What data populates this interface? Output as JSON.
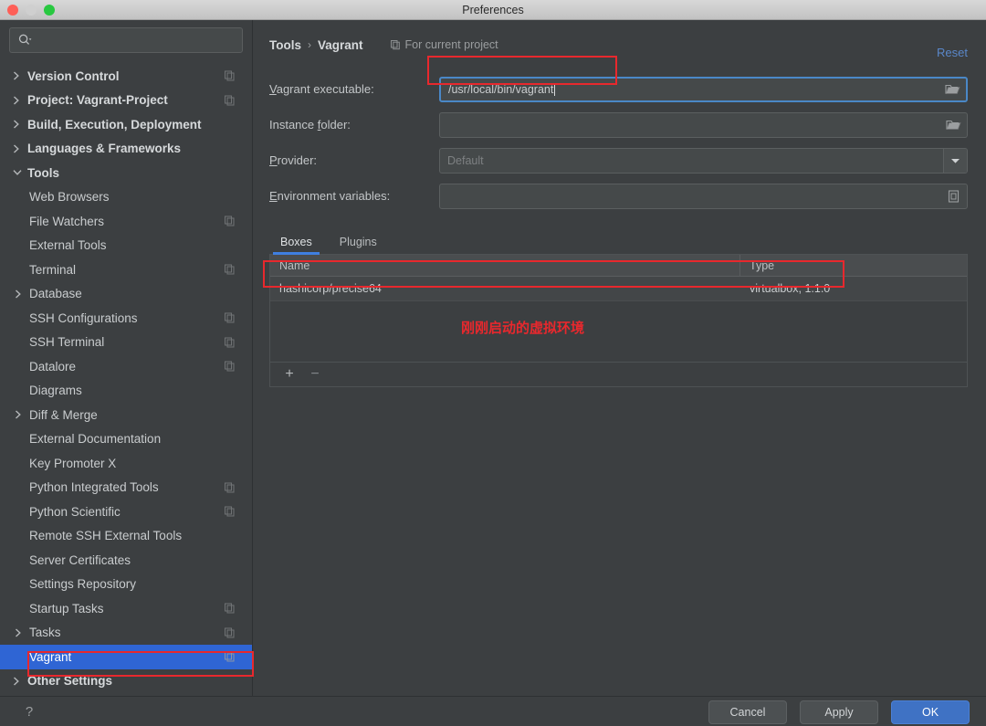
{
  "window": {
    "title": "Preferences",
    "traffic_lights": [
      "close",
      "minimize",
      "zoom"
    ]
  },
  "search": {
    "placeholder": "",
    "value": "",
    "icon": "search-icon"
  },
  "sidebar": {
    "items": [
      {
        "label": "Version Control",
        "level": 0,
        "arrow": "collapsed",
        "copy_icon": true,
        "selected": false,
        "bold": true
      },
      {
        "label": "Project: Vagrant-Project",
        "level": 0,
        "arrow": "collapsed",
        "copy_icon": true,
        "selected": false,
        "bold": true
      },
      {
        "label": "Build, Execution, Deployment",
        "level": 0,
        "arrow": "collapsed",
        "copy_icon": false,
        "selected": false,
        "bold": true
      },
      {
        "label": "Languages & Frameworks",
        "level": 0,
        "arrow": "collapsed",
        "copy_icon": false,
        "selected": false,
        "bold": true
      },
      {
        "label": "Tools",
        "level": 0,
        "arrow": "expanded",
        "copy_icon": false,
        "selected": false,
        "bold": true
      },
      {
        "label": "Web Browsers",
        "level": 1,
        "arrow": "none",
        "copy_icon": false,
        "selected": false,
        "bold": false
      },
      {
        "label": "File Watchers",
        "level": 1,
        "arrow": "none",
        "copy_icon": true,
        "selected": false,
        "bold": false
      },
      {
        "label": "External Tools",
        "level": 1,
        "arrow": "none",
        "copy_icon": false,
        "selected": false,
        "bold": false
      },
      {
        "label": "Terminal",
        "level": 1,
        "arrow": "none",
        "copy_icon": true,
        "selected": false,
        "bold": false
      },
      {
        "label": "Database",
        "level": 1,
        "arrow": "collapsed",
        "copy_icon": false,
        "selected": false,
        "bold": false
      },
      {
        "label": "SSH Configurations",
        "level": 1,
        "arrow": "none",
        "copy_icon": true,
        "selected": false,
        "bold": false
      },
      {
        "label": "SSH Terminal",
        "level": 1,
        "arrow": "none",
        "copy_icon": true,
        "selected": false,
        "bold": false
      },
      {
        "label": "Datalore",
        "level": 1,
        "arrow": "none",
        "copy_icon": true,
        "selected": false,
        "bold": false
      },
      {
        "label": "Diagrams",
        "level": 1,
        "arrow": "none",
        "copy_icon": false,
        "selected": false,
        "bold": false
      },
      {
        "label": "Diff & Merge",
        "level": 1,
        "arrow": "collapsed",
        "copy_icon": false,
        "selected": false,
        "bold": false
      },
      {
        "label": "External Documentation",
        "level": 1,
        "arrow": "none",
        "copy_icon": false,
        "selected": false,
        "bold": false
      },
      {
        "label": "Key Promoter X",
        "level": 1,
        "arrow": "none",
        "copy_icon": false,
        "selected": false,
        "bold": false
      },
      {
        "label": "Python Integrated Tools",
        "level": 1,
        "arrow": "none",
        "copy_icon": true,
        "selected": false,
        "bold": false
      },
      {
        "label": "Python Scientific",
        "level": 1,
        "arrow": "none",
        "copy_icon": true,
        "selected": false,
        "bold": false
      },
      {
        "label": "Remote SSH External Tools",
        "level": 1,
        "arrow": "none",
        "copy_icon": false,
        "selected": false,
        "bold": false
      },
      {
        "label": "Server Certificates",
        "level": 1,
        "arrow": "none",
        "copy_icon": false,
        "selected": false,
        "bold": false
      },
      {
        "label": "Settings Repository",
        "level": 1,
        "arrow": "none",
        "copy_icon": false,
        "selected": false,
        "bold": false
      },
      {
        "label": "Startup Tasks",
        "level": 1,
        "arrow": "none",
        "copy_icon": true,
        "selected": false,
        "bold": false
      },
      {
        "label": "Tasks",
        "level": 1,
        "arrow": "collapsed",
        "copy_icon": true,
        "selected": false,
        "bold": false
      },
      {
        "label": "Vagrant",
        "level": 1,
        "arrow": "none",
        "copy_icon": true,
        "selected": true,
        "bold": false
      },
      {
        "label": "Other Settings",
        "level": 0,
        "arrow": "collapsed",
        "copy_icon": false,
        "selected": false,
        "bold": true
      }
    ]
  },
  "main": {
    "breadcrumb": {
      "parent": "Tools",
      "separator": "›",
      "current": "Vagrant"
    },
    "scope_note": "For current project",
    "reset_label": "Reset",
    "form": [
      {
        "label_before": "V",
        "label_mnemonic": "",
        "label": "Vagrant executable:",
        "mnemonic": "V",
        "value": "/usr/local/bin/vagrant",
        "placeholder": "",
        "control": "file-browser",
        "focused": true
      },
      {
        "label": "Instance folder:",
        "mnemonic": "f",
        "value": "",
        "placeholder": "",
        "control": "file-browser",
        "focused": false
      },
      {
        "label": "Provider:",
        "mnemonic": "P",
        "value": "",
        "placeholder": "Default",
        "control": "combo",
        "focused": false
      },
      {
        "label": "Environment variables:",
        "mnemonic": "E",
        "value": "",
        "placeholder": "",
        "control": "expand",
        "focused": false
      }
    ],
    "tabs": [
      {
        "label": "Boxes",
        "active": true
      },
      {
        "label": "Plugins",
        "active": false
      }
    ],
    "table": {
      "columns": [
        "Name",
        "Type"
      ],
      "rows": [
        {
          "name": "hashicorp/precise64",
          "type": "virtualbox, 1.1.0"
        }
      ],
      "toolbar": {
        "add": "+",
        "remove": "−"
      }
    }
  },
  "annotations": {
    "note_text": "刚刚启动的虚拟环境",
    "color": "#e8282d",
    "boxes": [
      "vagrant-executable-field",
      "box-table-row",
      "sidebar-vagrant-item"
    ]
  },
  "footer": {
    "help": "?",
    "buttons": [
      {
        "label": "Cancel",
        "primary": false
      },
      {
        "label": "Apply",
        "primary": false
      },
      {
        "label": "OK",
        "primary": true
      }
    ]
  },
  "colors": {
    "accent_blue": "#2f65d4",
    "tab_underline": "#3f7fe0",
    "annotation_red": "#e8282d",
    "link_blue": "#5a87c9",
    "panel_bg": "#3c3f41"
  }
}
